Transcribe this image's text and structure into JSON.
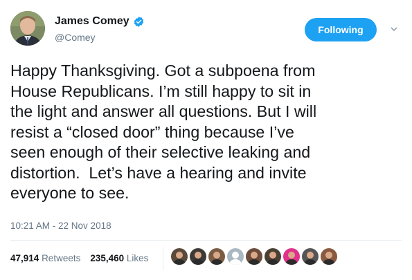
{
  "author": {
    "name": "James Comey",
    "handle": "@Comey",
    "verified": true,
    "avatar_icon": "profile-photo-icon"
  },
  "follow_button": {
    "label": "Following",
    "color": "#1da1f2"
  },
  "tweet": {
    "text": "Happy Thanksgiving. Got a subpoena from\nHouse Republicans. I’m still happy to sit in\nthe light and answer all questions. But I will\nresist a “closed door” thing because I’ve\nseen enough of their selective leaking and\ndistortion.  Let’s have a hearing and invite\neveryone to see.",
    "timestamp": "10:21 AM - 22 Nov 2018"
  },
  "stats": {
    "retweets_count": "47,914",
    "retweets_label": "Retweets",
    "likes_count": "235,460",
    "likes_label": "Likes"
  },
  "likers": [
    {
      "icon": "liker-avatar-icon",
      "color": "#5a4a3a"
    },
    {
      "icon": "liker-avatar-icon",
      "color": "#3d3a36"
    },
    {
      "icon": "liker-avatar-icon",
      "color": "#7a5c44"
    },
    {
      "icon": "default-avatar-icon",
      "color": "#aab8c2"
    },
    {
      "icon": "liker-avatar-icon",
      "color": "#6b4c3b"
    },
    {
      "icon": "liker-avatar-icon",
      "color": "#4a3f33"
    },
    {
      "icon": "liker-avatar-icon",
      "color": "#e0328a"
    },
    {
      "icon": "liker-avatar-icon",
      "color": "#555555"
    },
    {
      "icon": "liker-avatar-icon",
      "color": "#8a5a40"
    }
  ],
  "colors": {
    "text_primary": "#14171a",
    "text_secondary": "#657786",
    "verified_blue": "#1da1f2"
  }
}
